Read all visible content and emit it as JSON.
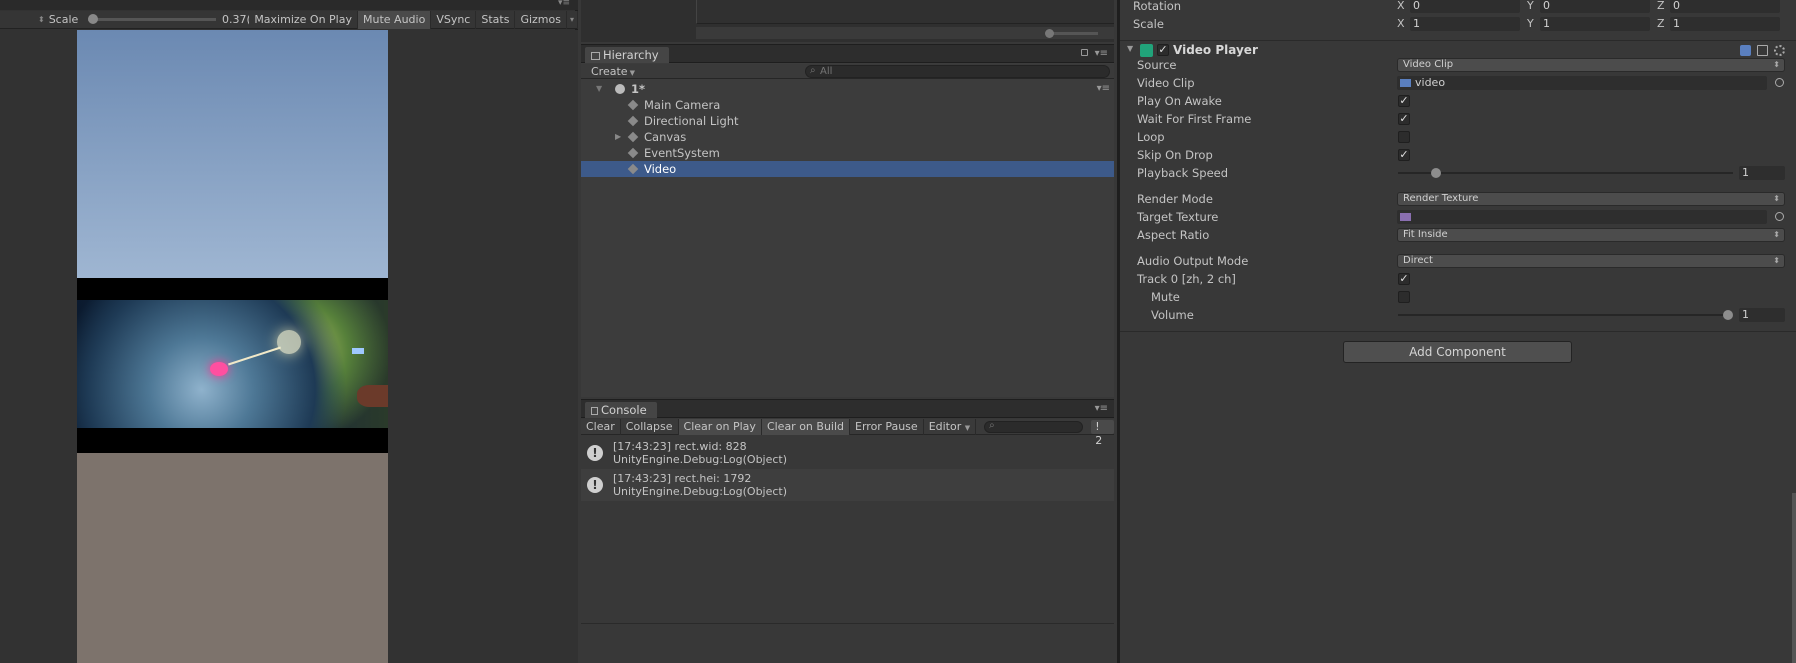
{
  "game": {
    "scale_label": "Scale",
    "scale_value": "0.37(",
    "scale_fraction": 0.0,
    "buttons": [
      {
        "label": "Maximize On Play",
        "active": false
      },
      {
        "label": "Mute Audio",
        "active": true
      },
      {
        "label": "VSync",
        "active": false
      },
      {
        "label": "Stats",
        "active": false
      },
      {
        "label": "Gizmos",
        "active": false
      }
    ]
  },
  "hierarchy": {
    "tab_label": "Hierarchy",
    "create_label": "Create",
    "search_placeholder": "All",
    "scene_name": "1*",
    "items": [
      {
        "label": "Main Camera",
        "expandable": false,
        "selected": false
      },
      {
        "label": "Directional Light",
        "expandable": false,
        "selected": false
      },
      {
        "label": "Canvas",
        "expandable": true,
        "selected": false
      },
      {
        "label": "EventSystem",
        "expandable": false,
        "selected": false
      },
      {
        "label": "Video",
        "expandable": false,
        "selected": true
      }
    ]
  },
  "console": {
    "tab_label": "Console",
    "buttons": [
      {
        "label": "Clear",
        "active": false
      },
      {
        "label": "Collapse",
        "active": false
      },
      {
        "label": "Clear on Play",
        "active": true
      },
      {
        "label": "Clear on Build",
        "active": true
      },
      {
        "label": "Error Pause",
        "active": false
      },
      {
        "label": "Editor",
        "active": false
      }
    ],
    "warning_count": "2",
    "logs": [
      {
        "line1": "[17:43:23] rect.wid: 828",
        "line2": "UnityEngine.Debug:Log(Object)"
      },
      {
        "line1": "[17:43:23] rect.hei: 1792",
        "line2": "UnityEngine.Debug:Log(Object)"
      }
    ]
  },
  "inspector": {
    "transform": {
      "rotation": {
        "label": "Rotation",
        "x": "0",
        "y": "0",
        "z": "0"
      },
      "scale": {
        "label": "Scale",
        "x": "1",
        "y": "1",
        "z": "1"
      }
    },
    "video_player": {
      "title": "Video Player",
      "enabled": true,
      "source": {
        "label": "Source",
        "value": "Video Clip"
      },
      "video_clip": {
        "label": "Video Clip",
        "value": "video"
      },
      "play_on_awake": {
        "label": "Play On Awake",
        "checked": true
      },
      "wait_first_frame": {
        "label": "Wait For First Frame",
        "checked": true
      },
      "loop": {
        "label": "Loop",
        "checked": false
      },
      "skip_on_drop": {
        "label": "Skip On Drop",
        "checked": true
      },
      "playback_speed": {
        "label": "Playback Speed",
        "value": "1",
        "fraction": 0.1
      },
      "render_mode": {
        "label": "Render Mode",
        "value": "Render Texture"
      },
      "target_texture": {
        "label": "Target Texture",
        "value": ""
      },
      "aspect_ratio": {
        "label": "Aspect Ratio",
        "value": "Fit Inside"
      },
      "audio_output_mode": {
        "label": "Audio Output Mode",
        "value": "Direct"
      },
      "track0": {
        "label": "Track 0 [zh, 2 ch]",
        "checked": true
      },
      "mute": {
        "label": "Mute",
        "checked": false
      },
      "volume": {
        "label": "Volume",
        "value": "1",
        "fraction": 1.0
      }
    },
    "add_component_label": "Add Component"
  },
  "colors": {
    "selection": "#3d5a8a",
    "panel_bg": "#383838",
    "video_player_icon": "#21a37a"
  }
}
